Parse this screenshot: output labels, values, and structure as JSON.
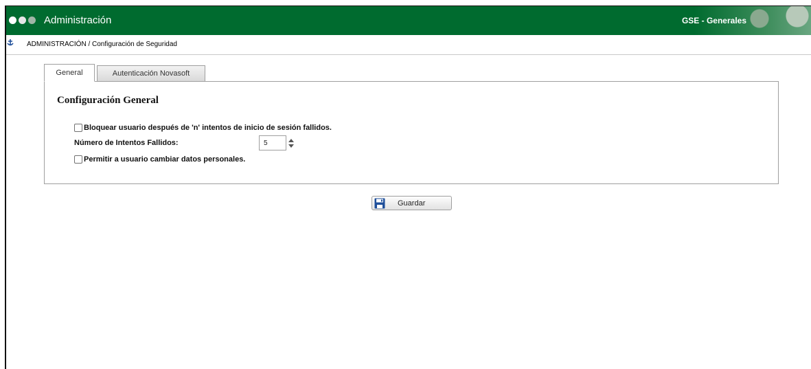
{
  "window": {
    "app_title": "Administración",
    "module_title": "GSE - Generales"
  },
  "breadcrumb": {
    "text": "ADMINISTRACIÓN / Configuración de Seguridad"
  },
  "tabs": [
    {
      "label": "General",
      "active": true
    },
    {
      "label": "Autenticación Novasoft",
      "active": false
    }
  ],
  "panel": {
    "section_title": "Configuración General",
    "lock_user_checkbox": {
      "label": "Bloquear usuario después de 'n' intentos de inicio de sesión fallidos.",
      "checked": false
    },
    "failed_attempts": {
      "label": "Número de Intentos Fallidos:",
      "value": "5"
    },
    "allow_change_checkbox": {
      "label": "Permitir a usuario cambiar datos personales.",
      "checked": false
    }
  },
  "actions": {
    "save_label": "Guardar",
    "save_icon": "floppy-disk-icon"
  },
  "colors": {
    "header_green": "#006b2f",
    "save_icon_blue": "#1f4f9a"
  }
}
